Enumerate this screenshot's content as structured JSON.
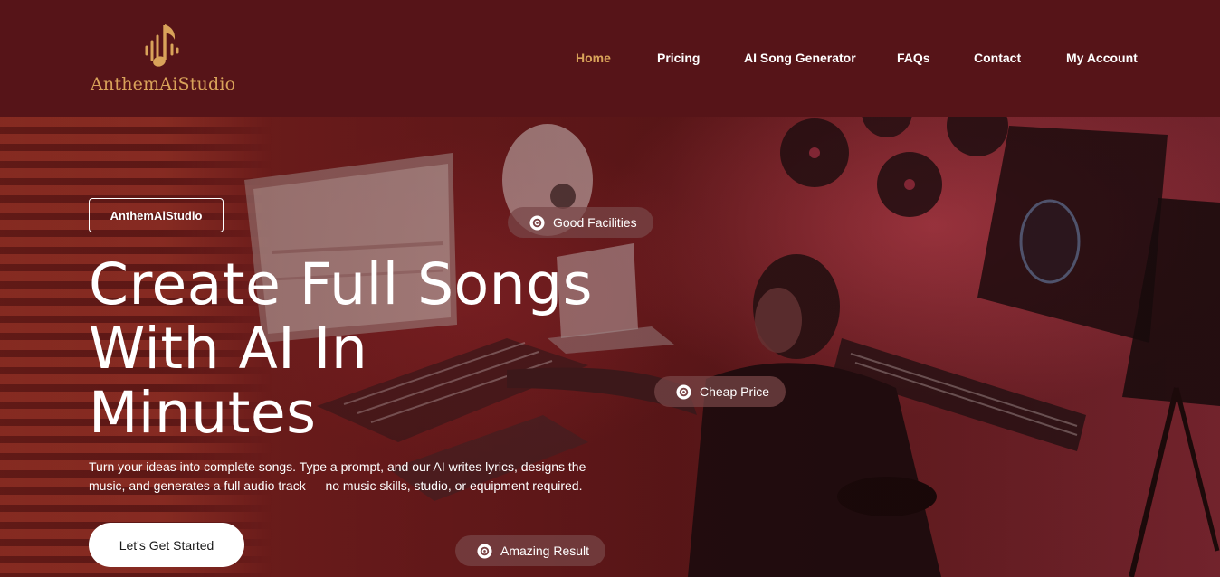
{
  "brand": {
    "name": "AnthemAiStudio",
    "accent_color": "#d9a35a",
    "logo_icon": "music-note-soundwave-icon"
  },
  "nav": {
    "items": [
      {
        "label": "Home",
        "active": true
      },
      {
        "label": "Pricing",
        "active": false
      },
      {
        "label": "AI Song Generator",
        "active": false
      },
      {
        "label": "FAQs",
        "active": false
      },
      {
        "label": "Contact",
        "active": false
      },
      {
        "label": "My Account",
        "active": false
      }
    ]
  },
  "hero": {
    "tag": "AnthemAiStudio",
    "title_lines": [
      "Create Full Songs",
      "With AI In",
      "Minutes"
    ],
    "description": "Turn your ideas into complete songs. Type a prompt, and our AI writes lyrics, designs the music, and generates a full audio track — no music skills, studio, or equipment required.",
    "cta_label": "Let's Get Started",
    "badges": [
      {
        "label": "Good Facilities",
        "icon": "vinyl-disc-icon"
      },
      {
        "label": "Cheap Price",
        "icon": "vinyl-disc-icon"
      },
      {
        "label": "Amazing Result",
        "icon": "vinyl-disc-icon"
      }
    ],
    "background": "music-studio-producer-photo"
  },
  "colors": {
    "header_bg": "#561418",
    "hero_tint": "#6e1c1d",
    "nav_text": "#ffffff",
    "cta_bg": "#ffffff"
  }
}
